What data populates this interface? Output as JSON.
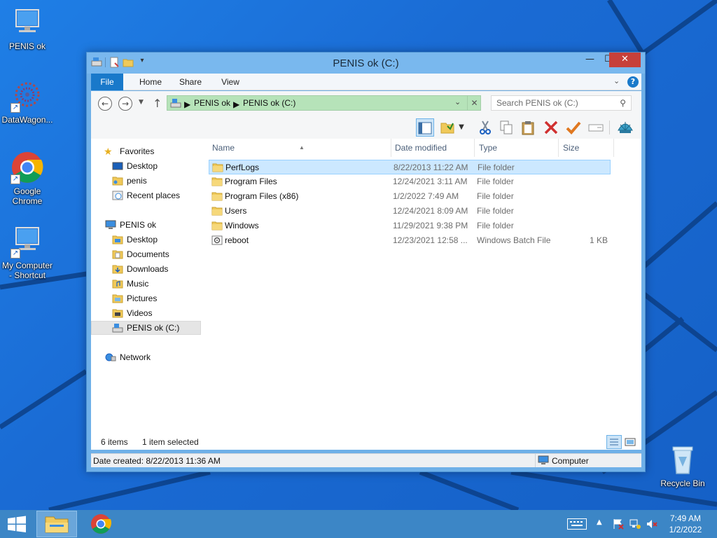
{
  "desktop": {
    "icons": [
      {
        "label": "PENIS ok"
      },
      {
        "label": "DataWagon..."
      },
      {
        "label": "Google Chrome"
      },
      {
        "label": "My Computer - Shortcut"
      },
      {
        "label": "Recycle Bin"
      }
    ]
  },
  "window": {
    "title": "PENIS ok (C:)",
    "controls": {
      "minimize": "—",
      "maximize": "☐",
      "close": "✕"
    },
    "ribbon_tabs": [
      "File",
      "Home",
      "Share",
      "View"
    ],
    "address": {
      "segments": [
        "PENIS ok",
        "PENIS ok (C:)"
      ],
      "search_placeholder": "Search PENIS ok (C:)"
    },
    "nav_pane": {
      "favorites_header": "Favorites",
      "favorites": [
        "Desktop",
        "penis",
        "Recent places"
      ],
      "computer_header": "PENIS ok",
      "computer_items": [
        "Desktop",
        "Documents",
        "Downloads",
        "Music",
        "Pictures",
        "Videos",
        "PENIS ok (C:)"
      ],
      "network": "Network"
    },
    "columns": [
      "Name",
      "Date modified",
      "Type",
      "Size"
    ],
    "files": [
      {
        "name": "PerfLogs",
        "date": "8/22/2013 11:22 AM",
        "type": "File folder",
        "size": "",
        "kind": "folder"
      },
      {
        "name": "Program Files",
        "date": "12/24/2021 3:11 AM",
        "type": "File folder",
        "size": "",
        "kind": "folder"
      },
      {
        "name": "Program Files (x86)",
        "date": "1/2/2022 7:49 AM",
        "type": "File folder",
        "size": "",
        "kind": "folder"
      },
      {
        "name": "Users",
        "date": "12/24/2021 8:09 AM",
        "type": "File folder",
        "size": "",
        "kind": "folder"
      },
      {
        "name": "Windows",
        "date": "11/29/2021 9:38 PM",
        "type": "File folder",
        "size": "",
        "kind": "folder"
      },
      {
        "name": "reboot",
        "date": "12/23/2021 12:58 ...",
        "type": "Windows Batch File",
        "size": "1 KB",
        "kind": "batch"
      }
    ],
    "selected_file_index": 0,
    "status": {
      "item_count": "6 items",
      "selection": "1 item selected"
    },
    "details": {
      "date_created": "Date created: 8/22/2013 11:36 AM",
      "location": "Computer"
    }
  },
  "taskbar": {
    "clock_time": "7:49 AM",
    "clock_date": "1/2/2022"
  },
  "colors": {
    "window_frame": "#79b8ee",
    "file_tab": "#1979ca",
    "address_bar": "#b6e3b9",
    "selection": "#cce8ff",
    "close_button": "#c7403a",
    "taskbar": "#3c86c6"
  }
}
